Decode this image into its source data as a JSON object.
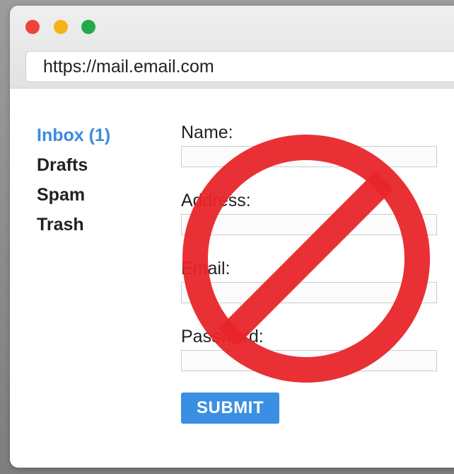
{
  "browser": {
    "url": "https://mail.email.com"
  },
  "sidebar": {
    "items": [
      {
        "label": "Inbox (1)",
        "active": true
      },
      {
        "label": "Drafts",
        "active": false
      },
      {
        "label": "Spam",
        "active": false
      },
      {
        "label": "Trash",
        "active": false
      }
    ]
  },
  "form": {
    "fields": [
      {
        "label": "Name:",
        "value": ""
      },
      {
        "label": "Address:",
        "value": ""
      },
      {
        "label": "Email:",
        "value": ""
      },
      {
        "label": "Password:",
        "value": ""
      }
    ],
    "submit_label": "SUBMIT"
  },
  "overlay": {
    "icon": "prohibited-icon",
    "color": "#e8252a"
  },
  "colors": {
    "accent": "#3b8fe2",
    "traffic_red": "#f0433a",
    "traffic_yellow": "#f5b31a",
    "traffic_green": "#22a94a"
  }
}
